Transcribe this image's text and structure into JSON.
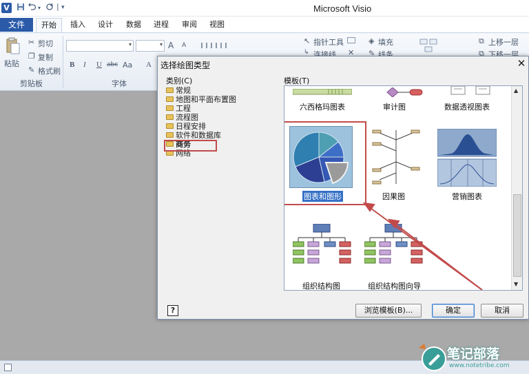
{
  "app": {
    "title": "Microsoft Visio",
    "icon_letter": "V"
  },
  "quick_access": {
    "save_icon": "save-icon",
    "undo_icon": "undo-icon",
    "redo_icon": "redo-icon",
    "sep": "|",
    "customize": "▾"
  },
  "tabs": {
    "file": "文件",
    "home": "开始",
    "insert": "插入",
    "design": "设计",
    "data": "数据",
    "process": "进程",
    "review": "审阅",
    "view": "视图"
  },
  "ribbon": {
    "paste": "粘贴",
    "cut": "剪切",
    "copy": "复制",
    "format_painter": "格式刷",
    "clipboard_group": "剪贴板",
    "font_group": "字体",
    "pointer_tool": "指针工具",
    "connector": "连接线",
    "fill": "填充",
    "line": "线条",
    "bring_forward": "上移一层",
    "send_backward": "下移一层",
    "bold": "B",
    "italic": "I",
    "underline": "U",
    "strike": "abc",
    "case": "Aa",
    "grow": "A",
    "shrink": "A"
  },
  "dialog": {
    "title": "选择绘图类型",
    "close": "✕",
    "category_label": "类别(C)",
    "template_label": "模板(T)",
    "categories": [
      {
        "label": "常规",
        "selected": false
      },
      {
        "label": "地图和平面布置图",
        "selected": false
      },
      {
        "label": "工程",
        "selected": false
      },
      {
        "label": "流程图",
        "selected": false
      },
      {
        "label": "日程安排",
        "selected": false
      },
      {
        "label": "软件和数据库",
        "selected": false
      },
      {
        "label": "商务",
        "selected": true
      },
      {
        "label": "网络",
        "selected": false
      }
    ],
    "templates": [
      {
        "label": "六西格玛图表",
        "selected": false
      },
      {
        "label": "审计图",
        "selected": false
      },
      {
        "label": "数据透视图表",
        "selected": false
      },
      {
        "label": "图表和图形",
        "selected": true
      },
      {
        "label": "因果图",
        "selected": false
      },
      {
        "label": "营销图表",
        "selected": false
      },
      {
        "label": "组织结构图",
        "selected": false
      },
      {
        "label": "组织结构图向导",
        "selected": false
      }
    ],
    "help": "?",
    "browse_button": "浏览模板(B)...",
    "ok_button": "确定",
    "cancel_button": "取消"
  },
  "watermark": {
    "text": "笔记部落",
    "url": "www.notetribe.com"
  },
  "colors": {
    "accent": "#2a5aa8",
    "highlight_red": "#c24a4a",
    "selection_blue": "#3470c6"
  }
}
